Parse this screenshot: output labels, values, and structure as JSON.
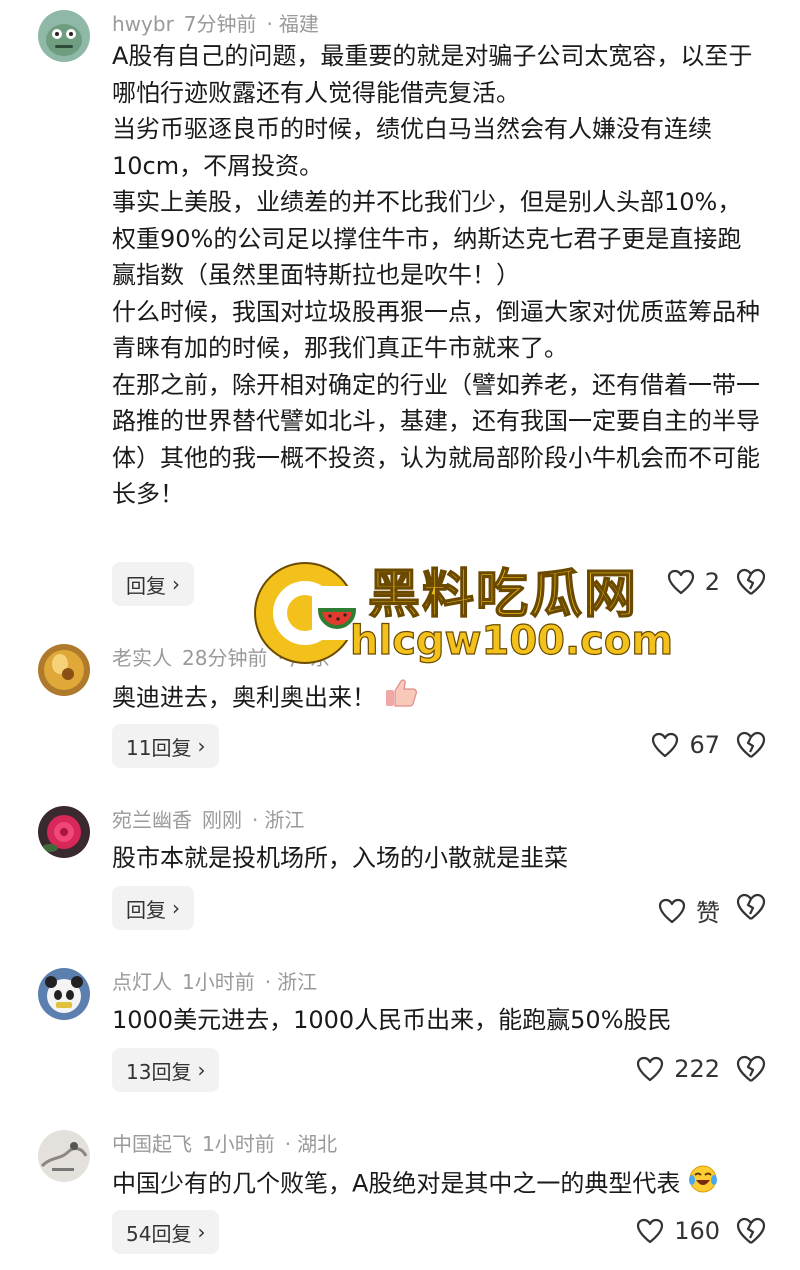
{
  "comments": [
    {
      "user": "hwybr",
      "time": "7分钟前",
      "region": "福建",
      "paragraphs": [
        "A股有自己的问题，最重要的就是对骗子公司太宽容，以至于哪怕行迹败露还有人觉得能借壳复活。",
        "当劣币驱逐良币的时候，绩优白马当然会有人嫌没有连续10cm，不屑投资。",
        "事实上美股，业绩差的并不比我们少，但是别人头部10%，权重90%的公司足以撑住牛市，纳斯达克七君子更是直接跑赢指数（虽然里面特斯拉也是吹牛！）",
        "什么时候，我国对垃圾股再狠一点，倒逼大家对优质蓝筹品种青睐有加的时候，那我们真正牛市就来了。",
        "在那之前，除开相对确定的行业（譬如养老，还有借着一带一路推的世界替代譬如北斗，基建，还有我国一定要自主的半导体）其他的我一概不投资，认为就局部阶段小牛机会而不可能长多！"
      ],
      "reply_label": "回复",
      "likes": "2"
    },
    {
      "user": "老实人",
      "time": "28分钟前",
      "region": "广东",
      "text": "奥迪进去，奥利奥出来！",
      "reply_label": "11回复",
      "likes": "67"
    },
    {
      "user": "宛兰幽香",
      "time": "刚刚",
      "region": "浙江",
      "text": "股市本就是投机场所，入场的小散就是韭菜",
      "reply_label": "回复",
      "likes": "赞"
    },
    {
      "user": "点灯人",
      "time": "1小时前",
      "region": "浙江",
      "text": "1000美元进去，1000人民币出来，能跑赢50%股民",
      "reply_label": "13回复",
      "likes": "222"
    },
    {
      "user": "中国起飞",
      "time": "1小时前",
      "region": "湖北",
      "text": "中国少有的几个败笔，A股绝对是其中之一的典型代表",
      "reply_label": "54回复",
      "likes": "160"
    }
  ],
  "separator": "·",
  "watermark": {
    "title": "黑料吃瓜网",
    "url": "hlcgw100.com"
  },
  "colors": {
    "meta": "#9a9a9a",
    "reply_bg": "#f2f2f2",
    "watermark": "#f3c11b"
  },
  "icons": {
    "like": "heart-outline-icon",
    "dislike": "broken-heart-icon",
    "chevron": "chevron-right-icon"
  }
}
